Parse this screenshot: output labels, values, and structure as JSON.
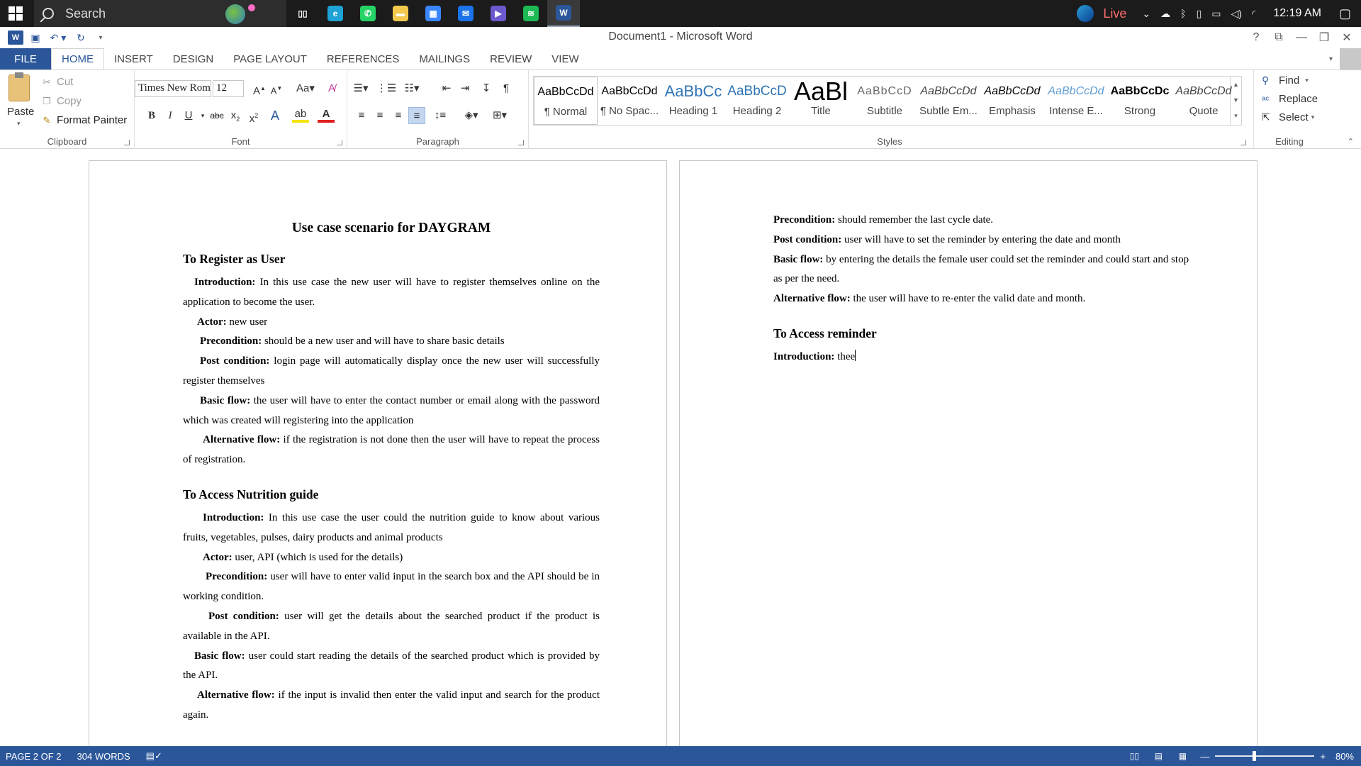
{
  "taskbar": {
    "search_label": "Search",
    "apps": [
      {
        "name": "task-view-icon",
        "glyph": "▯▯",
        "color": "#1b1b1b"
      },
      {
        "name": "edge-icon",
        "glyph": "e",
        "color": "#1fa3d6"
      },
      {
        "name": "whatsapp-icon",
        "glyph": "✆",
        "color": "#25d366"
      },
      {
        "name": "file-explorer-icon",
        "glyph": "▬",
        "color": "#f2c94c"
      },
      {
        "name": "microsoft-store-icon",
        "glyph": "▦",
        "color": "#3a86ff"
      },
      {
        "name": "mail-icon",
        "glyph": "✉",
        "color": "#1a73e8"
      },
      {
        "name": "power-automate-icon",
        "glyph": "▶",
        "color": "#6a5acd"
      },
      {
        "name": "spotify-icon",
        "glyph": "≋",
        "color": "#1db954"
      },
      {
        "name": "word-taskbar-icon",
        "glyph": "W",
        "color": "#2b579a"
      }
    ],
    "tray": {
      "live_label": "Live",
      "time": "12:19 AM"
    }
  },
  "titlebar": {
    "title": "Document1 - Microsoft Word"
  },
  "tabs": {
    "file": "FILE",
    "items": [
      "HOME",
      "INSERT",
      "DESIGN",
      "PAGE LAYOUT",
      "REFERENCES",
      "MAILINGS",
      "REVIEW",
      "VIEW"
    ]
  },
  "clipboard": {
    "paste": "Paste",
    "cut": "Cut",
    "copy": "Copy",
    "format_painter": "Format Painter",
    "label": "Clipboard"
  },
  "font": {
    "family": "Times New Roman",
    "size": "12",
    "label": "Font"
  },
  "paragraph": {
    "label": "Paragraph"
  },
  "styles": {
    "label": "Styles",
    "items": [
      {
        "preview": "AaBbCcDd",
        "name": "¶ Normal"
      },
      {
        "preview": "AaBbCcDd",
        "name": "¶ No Spac..."
      },
      {
        "preview": "AaBbCc",
        "name": "Heading 1"
      },
      {
        "preview": "AaBbCcD",
        "name": "Heading 2"
      },
      {
        "preview": "AaBl",
        "name": "Title"
      },
      {
        "preview": "AaBbCcD",
        "name": "Subtitle"
      },
      {
        "preview": "AaBbCcDd",
        "name": "Subtle Em..."
      },
      {
        "preview": "AaBbCcDd",
        "name": "Emphasis"
      },
      {
        "preview": "AaBbCcDd",
        "name": "Intense E..."
      },
      {
        "preview": "AaBbCcDc",
        "name": "Strong"
      },
      {
        "preview": "AaBbCcDd",
        "name": "Quote"
      }
    ]
  },
  "editing": {
    "find": "Find",
    "replace": "Replace",
    "select": "Select",
    "label": "Editing"
  },
  "page1": {
    "title": "Use case scenario for DAYGRAM",
    "section1": {
      "heading": "To Register as User",
      "intro_label": "Introduction:",
      "intro_text": " In this use case the new user will have to register themselves online on the application to become the user.",
      "actor_label": "Actor:",
      "actor_text": " new user",
      "pre_label": "Precondition:",
      "pre_text": " should be a new user and will have to share basic details",
      "post_label": "Post condition:",
      "post_text": " login page will automatically display once the new user will successfully register themselves",
      "basic_label": "Basic flow:",
      "basic_text": " the user will have to enter the contact number or email along with the password which was created will registering into the application",
      "alt_label": "Alternative flow:",
      "alt_text": " if the registration is not done then the user will have to repeat the process of registration."
    },
    "section2": {
      "heading": "To Access Nutrition guide",
      "intro_label": "Introduction:",
      "intro_text": " In this use case the user could the nutrition guide to know about various fruits, vegetables, pulses, dairy products and animal products",
      "actor_label": "Actor:",
      "actor_text": " user, API (which is used for the details)",
      "pre_label": "Precondition:",
      "pre_text": " user will have to enter valid input in the search box and the API should be in working condition.",
      "post_label": "Post condition:",
      "post_text": " user will get the details about the searched product if the product is available in the API.",
      "basic_label": "Basic flow:",
      "basic_text": " user could start reading the details of the searched product which is provided by the API.",
      "alt_label": "Alternative flow:",
      "alt_text": " if the input is invalid then enter the valid input and search for the product again."
    }
  },
  "page2": {
    "pre_label": "Precondition:",
    "pre_text": " should remember the last cycle date.",
    "post_label": "Post condition:",
    "post_text": "  user will have to set the reminder by entering the date and month",
    "basic_label": "Basic flow:",
    "basic_text": " by entering the details the female user could set the reminder and could start and stop as per the need.",
    "alt_label": "Alternative flow:",
    "alt_text": " the user will have to re-enter the valid date and month.",
    "heading": "To Access reminder",
    "intro_label": "Introduction:",
    "intro_text": " thee"
  },
  "statusbar": {
    "page": "PAGE 2 OF 2",
    "words": "304 WORDS",
    "zoom": "80%",
    "zoom_level": 0.8
  }
}
